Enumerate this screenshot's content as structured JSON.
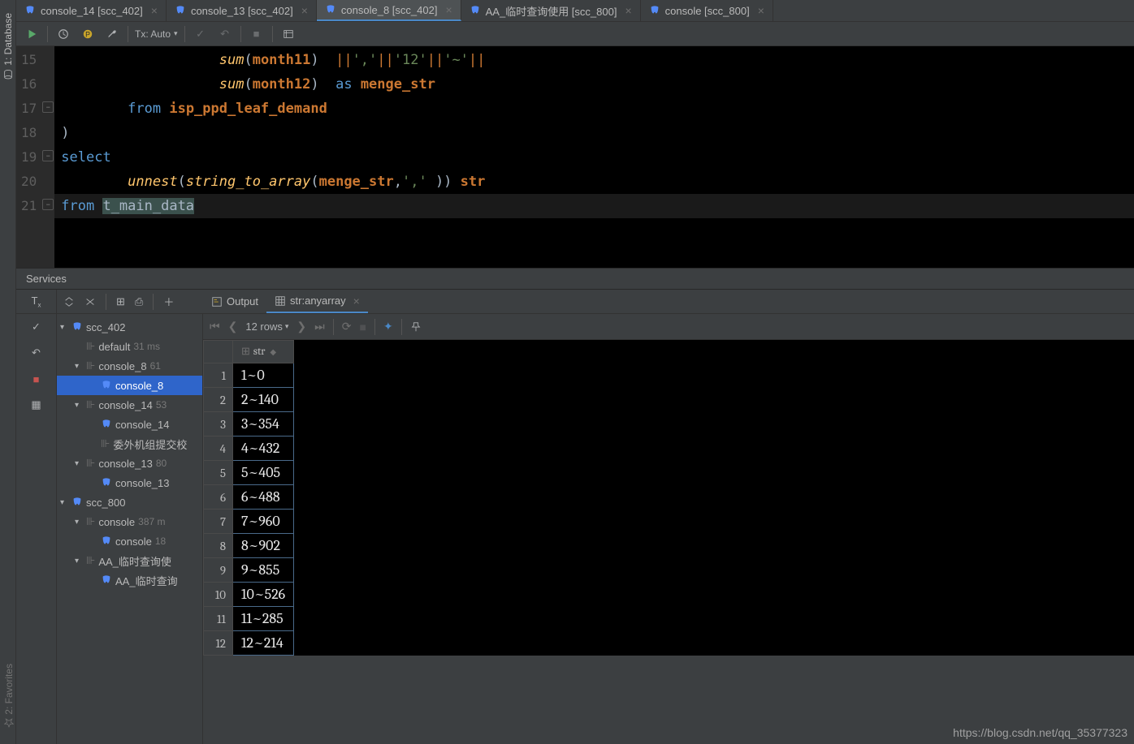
{
  "ide": {
    "sidetabs": {
      "database": "1: Database",
      "favorites": "2: Favorites"
    },
    "tabs": [
      {
        "label": "console_14 [scc_402]",
        "active": false
      },
      {
        "label": "console_13 [scc_402]",
        "active": false
      },
      {
        "label": "console_8 [scc_402]",
        "active": true
      },
      {
        "label": "AA_临时查询使用 [scc_800]",
        "active": false
      },
      {
        "label": "console [scc_800]",
        "active": false
      }
    ],
    "toolbar": {
      "tx_label": "Tx: Auto"
    },
    "editor_start_line": 15,
    "code": [
      {
        "n": 15,
        "tok": [
          [
            "func",
            "       sum"
          ],
          [
            "paren",
            "("
          ],
          [
            "id",
            "month11"
          ],
          [
            "paren",
            ")  "
          ],
          [
            "op",
            "||"
          ],
          [
            "str",
            "','"
          ],
          [
            "op",
            "||"
          ],
          [
            "str",
            "'12'"
          ],
          [
            "op",
            "||"
          ],
          [
            "str",
            "'~'"
          ],
          [
            "op",
            "||"
          ]
        ]
      },
      {
        "n": 16,
        "tok": [
          [
            "func",
            "       sum"
          ],
          [
            "paren",
            "("
          ],
          [
            "id",
            "month12"
          ],
          [
            "paren",
            ")  "
          ],
          [
            "kw2",
            "as"
          ],
          [
            "paren",
            " "
          ],
          [
            "id",
            "menge_str"
          ]
        ]
      },
      {
        "n": 17,
        "tok": [
          [
            "kw2",
            "    from "
          ],
          [
            "id",
            "isp_ppd_leaf_demand"
          ]
        ]
      },
      {
        "n": 18,
        "tok": [
          [
            "paren",
            ")"
          ]
        ]
      },
      {
        "n": 19,
        "tok": [
          [
            "kw2",
            "select"
          ]
        ]
      },
      {
        "n": 20,
        "tok": [
          [
            "func",
            "    unnest"
          ],
          [
            "paren",
            "("
          ],
          [
            "func",
            "string_to_array"
          ],
          [
            "paren",
            "("
          ],
          [
            "id",
            "menge_str"
          ],
          [
            "paren",
            ","
          ],
          [
            "str",
            "','"
          ],
          [
            "paren",
            " )) "
          ],
          [
            "id",
            "str"
          ]
        ]
      },
      {
        "n": 21,
        "tok": [
          [
            "kw2",
            "from "
          ],
          [
            "hl-tbl",
            "t_main_data"
          ]
        ]
      }
    ]
  },
  "services": {
    "title": "Services",
    "tabs": {
      "output": "Output",
      "result": "str:anyarray"
    },
    "grid_toolbar": {
      "rows_label": "12 rows"
    },
    "tree": [
      {
        "d": 0,
        "arrow": "▾",
        "ico": "db",
        "label": "scc_402",
        "dim": ""
      },
      {
        "d": 1,
        "arrow": "",
        "ico": "conn",
        "label": "default",
        "dim": "31 ms"
      },
      {
        "d": 1,
        "arrow": "▾",
        "ico": "conn",
        "label": "console_8",
        "dim": "61"
      },
      {
        "d": 2,
        "arrow": "",
        "ico": "pg",
        "label": "console_8",
        "dim": "",
        "sel": true
      },
      {
        "d": 1,
        "arrow": "▾",
        "ico": "conn",
        "label": "console_14",
        "dim": "53"
      },
      {
        "d": 2,
        "arrow": "",
        "ico": "pg",
        "label": "console_14",
        "dim": ""
      },
      {
        "d": 2,
        "arrow": "",
        "ico": "conn",
        "label": "委外机组提交校",
        "dim": ""
      },
      {
        "d": 1,
        "arrow": "▾",
        "ico": "conn",
        "label": "console_13",
        "dim": "80"
      },
      {
        "d": 2,
        "arrow": "",
        "ico": "pg",
        "label": "console_13",
        "dim": ""
      },
      {
        "d": 0,
        "arrow": "▾",
        "ico": "db",
        "label": "scc_800",
        "dim": ""
      },
      {
        "d": 1,
        "arrow": "▾",
        "ico": "conn",
        "label": "console",
        "dim": "387 m"
      },
      {
        "d": 2,
        "arrow": "",
        "ico": "pg",
        "label": "console",
        "dim": "18"
      },
      {
        "d": 1,
        "arrow": "▾",
        "ico": "conn",
        "label": "AA_临时查询使",
        "dim": ""
      },
      {
        "d": 2,
        "arrow": "",
        "ico": "pg",
        "label": "AA_临时查询",
        "dim": ""
      }
    ]
  },
  "chart_data": {
    "type": "table",
    "columns": [
      "str"
    ],
    "rows": [
      [
        "1~0"
      ],
      [
        "2~140"
      ],
      [
        "3~354"
      ],
      [
        "4~432"
      ],
      [
        "5~405"
      ],
      [
        "6~488"
      ],
      [
        "7~960"
      ],
      [
        "8~902"
      ],
      [
        "9~855"
      ],
      [
        "10~526"
      ],
      [
        "11~285"
      ],
      [
        "12~214"
      ]
    ]
  },
  "watermark": "https://blog.csdn.net/qq_35377323"
}
